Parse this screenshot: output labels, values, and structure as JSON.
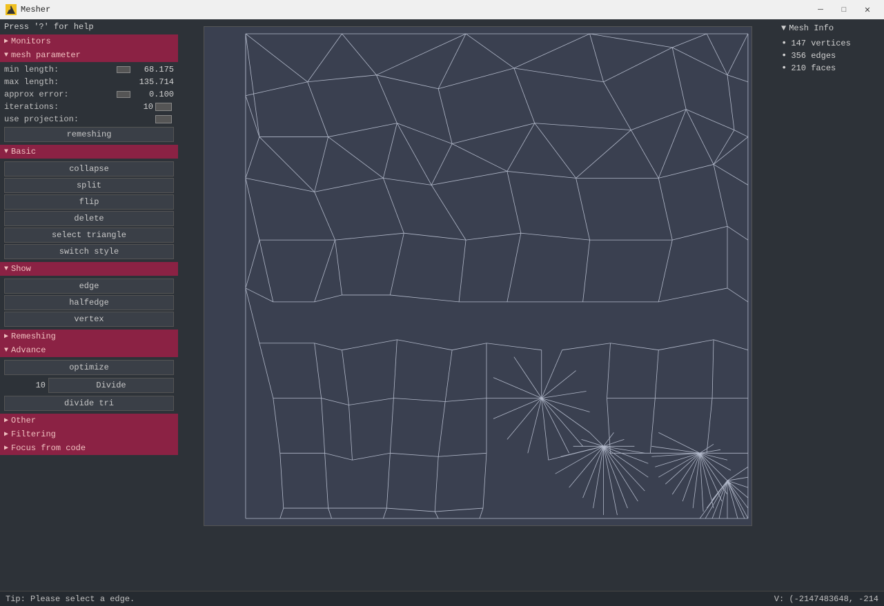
{
  "titlebar": {
    "icon": "M",
    "title": "Mesher",
    "minimize": "─",
    "maximize": "□",
    "close": "✕"
  },
  "help": {
    "text": "Press '?' for help"
  },
  "sections": {
    "monitors": {
      "label": "Monitors",
      "collapsed": true,
      "arrow": "▶"
    },
    "mesh_parameter": {
      "label": "mesh parameter",
      "collapsed": false,
      "arrow": "▼"
    },
    "basic": {
      "label": "Basic",
      "collapsed": false,
      "arrow": "▼"
    },
    "show": {
      "label": "Show",
      "collapsed": false,
      "arrow": "▼"
    },
    "remeshing": {
      "label": "Remeshing",
      "collapsed": true,
      "arrow": "▶"
    },
    "advance": {
      "label": "Advance",
      "collapsed": false,
      "arrow": "▼"
    },
    "other": {
      "label": "Other",
      "collapsed": true,
      "arrow": "▶"
    },
    "filtering": {
      "label": "Filtering",
      "collapsed": true,
      "arrow": "▶"
    },
    "focus_from_code": {
      "label": "Focus from code",
      "collapsed": true,
      "arrow": "▶"
    }
  },
  "params": {
    "min_length_label": "min length:",
    "min_length_value": "68.175",
    "max_length_label": "max length:",
    "max_length_value": "135.714",
    "approx_error_label": "approx error:",
    "approx_error_value": "0.100",
    "iterations_label": "iterations:",
    "iterations_value": "10",
    "use_projection_label": "use projection:",
    "remeshing_btn": "remeshing"
  },
  "basic_buttons": {
    "collapse": "collapse",
    "split": "split",
    "flip": "flip",
    "delete": "delete",
    "select_triangle": "select triangle",
    "switch_style": "switch style"
  },
  "show_buttons": {
    "edge": "edge",
    "halfedge": "halfedge",
    "vertex": "vertex"
  },
  "advance": {
    "optimize_btn": "optimize",
    "divide_value": "10",
    "divide_btn": "Divide",
    "divide_tri_btn": "divide tri"
  },
  "mesh_info": {
    "header": "Mesh Info",
    "vertices": "147 vertices",
    "edges": "356 edges",
    "faces": "210 faces"
  },
  "statusbar": {
    "tip": "Tip: Please select a edge.",
    "coords": "V: (-2147483648, -214"
  },
  "colors": {
    "accent": "#8b2244",
    "panel_bg": "#2d3238",
    "mesh_bg": "#3a4050",
    "line_color": "#c8cfe0"
  }
}
